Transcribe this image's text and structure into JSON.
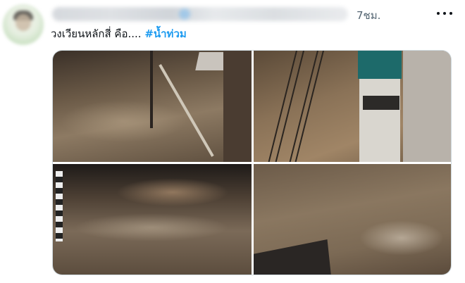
{
  "tweet": {
    "time": "7ชม.",
    "text": "วงเวียนหลักสี่ คือ.... ",
    "hashtag": "#น้ำท่วม"
  },
  "colors": {
    "hashtag": "#1d9bf0",
    "secondary_text": "#536471",
    "media_border": "#cfd9de"
  },
  "icons": {
    "more": "more-options-icon"
  }
}
